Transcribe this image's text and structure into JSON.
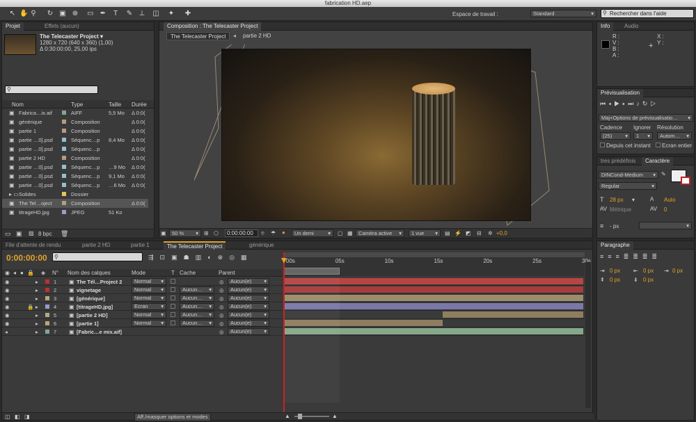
{
  "window": {
    "title": "fabrication HD.aep"
  },
  "workspace": {
    "label": "Espace de travail :",
    "value": "Standard",
    "help_placeholder": "Rechercher dans l'aide"
  },
  "project": {
    "tabs": [
      "Projet",
      "Effets (aucun)"
    ],
    "item_name": "The Telecaster Project ▾",
    "item_size": "1280 x 720  (640 x 360) (1,00)",
    "item_duration": "Δ 0:30:00:00, 25,00 ips",
    "bpc": "8 bpc",
    "columns": [
      "Nom",
      "Type",
      "Taille",
      "Durée"
    ],
    "rows": [
      {
        "name": "Fabrica…ix.aif",
        "type": "AIFF",
        "size": "5,5 Mo",
        "dur": "Δ 0:0(",
        "color": "#7fa89a"
      },
      {
        "name": "générique",
        "type": "Composition",
        "size": "",
        "dur": "Δ 0:0(",
        "color": "#b59c7c"
      },
      {
        "name": "partie 1",
        "type": "Composition",
        "size": "",
        "dur": "Δ 0:0(",
        "color": "#b59c7c"
      },
      {
        "name": "partie …0].psd",
        "type": "Séquenc…p",
        "size": "8,4 Mo",
        "dur": "Δ 0:0(",
        "color": "#8fc3c9"
      },
      {
        "name": "partie …0].psd",
        "type": "Séquenc…p",
        "size": "",
        "dur": "Δ 0:0(",
        "color": "#8fc3c9"
      },
      {
        "name": "partie 2 HD",
        "type": "Composition",
        "size": "",
        "dur": "Δ 0:0(",
        "color": "#b59c7c"
      },
      {
        "name": "partie …0].psd",
        "type": "Séquenc…p",
        "size": "…9 Mo",
        "dur": "Δ 0:0(",
        "color": "#8fc3c9"
      },
      {
        "name": "partie …0].psd",
        "type": "Séquenc…p",
        "size": "9,1 Mo",
        "dur": "Δ 0:0(",
        "color": "#8fc3c9"
      },
      {
        "name": "partie …0].psd",
        "type": "Séquenc…p",
        "size": "…6 Mo",
        "dur": "Δ 0:0(",
        "color": "#8fc3c9"
      },
      {
        "name": "Solides",
        "type": "Dossier",
        "size": "",
        "dur": "",
        "color": "#e2c85a"
      },
      {
        "name": "The Tel…oject",
        "type": "Composition",
        "size": "",
        "dur": "Δ 0:0(",
        "color": "#b59c7c"
      },
      {
        "name": "titrageHD.jpg",
        "type": "JPEG",
        "size": "51 Ko",
        "dur": "",
        "color": "#9a9ad0"
      }
    ]
  },
  "composition": {
    "tab": "Composition : The Telecaster Project",
    "sub_tabs": [
      "The Telecaster Project",
      "partie 2 HD"
    ],
    "zoom": "50 %",
    "time": "0:00:00:00",
    "resolution": "Un demi",
    "camera": "Caméra active",
    "views": "1 vue",
    "offset": "+0,0"
  },
  "info": {
    "tabs": [
      "Info",
      "Audio"
    ],
    "labels": [
      "R :",
      "V :",
      "B :",
      "A :"
    ],
    "xy": [
      "X :",
      "Y :"
    ]
  },
  "preview": {
    "title": "Prévisualisation",
    "option": "Maj+Options de prévisualisatio…",
    "cadence_label": "Cadence",
    "ignorer_label": "Ignorer",
    "resolution_label": "Résolution",
    "cadence": "(25)",
    "ignorer": "1",
    "resolution": "Autom…",
    "check1": "Depuis cet instant",
    "check2": "Ecran entier"
  },
  "character": {
    "tabs": [
      "tres prédéfinis",
      "Caractère"
    ],
    "font": "DINCond-Medium",
    "style": "Regular",
    "size": "28 px",
    "leading": "Auto",
    "kerning": "Métrique",
    "tracking": "0",
    "indent": "- px"
  },
  "paragraph": {
    "title": "Paragraphe",
    "values": [
      "0 px",
      "0 px",
      "0 px",
      "0 px",
      "0 px"
    ]
  },
  "timeline": {
    "tabs": [
      "File d'attente de rendu",
      "partie 2 HD",
      "partie 1",
      "The Telecaster Project",
      "générique"
    ],
    "time": "0:00:00:00",
    "headers": {
      "num": "N°",
      "name": "Nom des calques",
      "mode": "Mode",
      "t": "T",
      "cache": "Cache",
      "parent": "Parent"
    },
    "ticks": [
      "00s",
      "05s",
      "10s",
      "15s",
      "20s",
      "25s",
      "30s"
    ],
    "layers": [
      {
        "num": "1",
        "name": "The Tél…Project 2",
        "mode": "Normal",
        "cache": "",
        "parent": "Aucun(e)",
        "label": "#c03030",
        "bar": "#b84444",
        "start": 0,
        "end": 1
      },
      {
        "num": "2",
        "name": "vignetage",
        "mode": "Normal",
        "cache": "Aucun…",
        "parent": "Aucun(e)",
        "label": "#c03030",
        "bar": "#a83c3c",
        "start": 0,
        "end": 1
      },
      {
        "num": "3",
        "name": "[générique]",
        "mode": "Normal",
        "cache": "Aucun…",
        "parent": "Aucun(e)",
        "label": "#b8a77c",
        "bar": "#9c8c6c",
        "start": 0,
        "end": 1
      },
      {
        "num": "4",
        "name": "[titrageHD.jpg]",
        "mode": "Ecran",
        "cache": "Aucun…",
        "parent": "Aucun(e)",
        "label": "#9a9ad0",
        "bar": "#7a78a8",
        "start": 0,
        "end": 1
      },
      {
        "num": "5",
        "name": "[partie 2 HD]",
        "mode": "Normal",
        "cache": "Aucun…",
        "parent": "Aucun(e)",
        "label": "#b8a77c",
        "bar": "#8e7e60",
        "start": 0.53,
        "end": 1
      },
      {
        "num": "6",
        "name": "[partie 1]",
        "mode": "Normal",
        "cache": "Aucun…",
        "parent": "Aucun(e)",
        "label": "#b8a77c",
        "bar": "#8e7e60",
        "start": 0,
        "end": 0.53
      },
      {
        "num": "7",
        "name": "[Fabric…e mix.aif]",
        "mode": "",
        "cache": "",
        "parent": "Aucun(e)",
        "label": "#7fa89a",
        "bar": "#86a88a",
        "start": 0,
        "end": 1
      }
    ],
    "footer": "Aff./masquer options et modes"
  },
  "colors": {
    "accent": "#e1a22a",
    "playhead": "#d02020"
  }
}
